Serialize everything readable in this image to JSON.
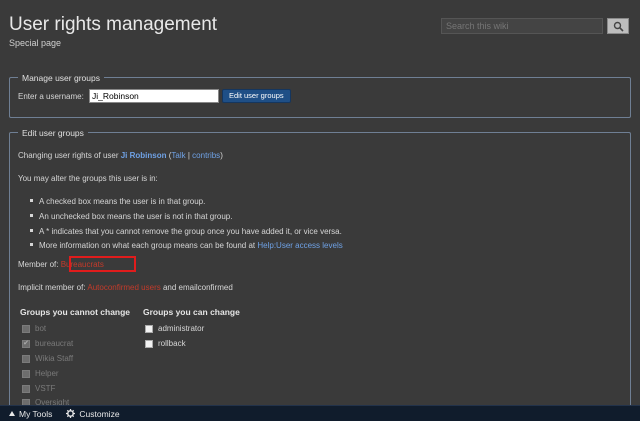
{
  "header": {
    "title": "User rights management",
    "subtitle": "Special page",
    "search_placeholder": "Search this wiki"
  },
  "manage": {
    "legend": "Manage user groups",
    "username_label": "Enter a username:",
    "username_value": "Ji_Robinson",
    "button_label": "Edit user groups"
  },
  "edit": {
    "legend": "Edit user groups",
    "changing_prefix": "Changing user rights of user ",
    "user_name": "Ji Robinson",
    "paren_open": " (",
    "talk": "Talk",
    "sep": " | ",
    "contribs": "contribs",
    "paren_close": ")",
    "alter_text": "You may alter the groups this user is in:",
    "bullets": [
      "A checked box means the user is in that group.",
      "An unchecked box means the user is not in that group.",
      "A * indicates that you cannot remove the group once you have added it, or vice versa."
    ],
    "more_info_prefix": "More information on what each group means can be found at ",
    "more_info_link": "Help:User access levels",
    "member_of_label": "Member of: ",
    "member_of_value": "Bureaucrats",
    "implicit_label": "Implicit member of: ",
    "implicit_value": "Autoconfirmed users",
    "implicit_suffix": " and emailconfirmed",
    "cannot_change_heading": "Groups you cannot change",
    "can_change_heading": "Groups you can change",
    "cannot_change": [
      {
        "label": "bot",
        "checked": false
      },
      {
        "label": "bureaucrat",
        "checked": true
      },
      {
        "label": "Wikia Staff",
        "checked": false
      },
      {
        "label": "Helper",
        "checked": false
      },
      {
        "label": "VSTF",
        "checked": false
      },
      {
        "label": "Oversight",
        "checked": false
      }
    ],
    "can_change": [
      {
        "label": "administrator",
        "checked": false
      },
      {
        "label": "rollback",
        "checked": false
      }
    ]
  },
  "toolbar": {
    "my_tools": "My Tools",
    "customize": "Customize"
  },
  "colors": {
    "background": "#3a3a3a",
    "link": "#6fa2e6",
    "redlink": "#c43a2a",
    "highlight": "#e01c1c",
    "button": "#1f4f86",
    "toolbar": "#101c2c"
  }
}
